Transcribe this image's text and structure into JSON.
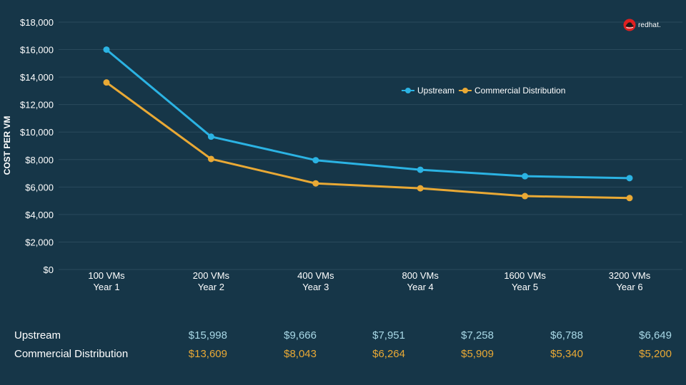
{
  "logo": {
    "text": "redhat."
  },
  "colors": {
    "background": "#163648",
    "upstream": "#2BB3E3",
    "commercial": "#E9A935",
    "grid": "#2A4A5C",
    "table_upstream_text": "#A8D8E6"
  },
  "chart_data": {
    "type": "line",
    "categories": [
      [
        "100 VMs",
        "Year 1"
      ],
      [
        "200 VMs",
        "Year 2"
      ],
      [
        "400 VMs",
        "Year 3"
      ],
      [
        "800 VMs",
        "Year 4"
      ],
      [
        "1600 VMs",
        "Year 5"
      ],
      [
        "3200 VMs",
        "Year 6"
      ]
    ],
    "series": [
      {
        "name": "Upstream",
        "values": [
          15998,
          9666,
          7951,
          7258,
          6788,
          6649
        ]
      },
      {
        "name": "Commercial Distribution",
        "values": [
          13609,
          8043,
          6264,
          5909,
          5340,
          5200
        ]
      }
    ],
    "ylabel": "COST PER VM",
    "xlabel": "",
    "ylim": [
      0,
      18000
    ],
    "yticks": [
      0,
      2000,
      4000,
      6000,
      8000,
      10000,
      12000,
      14000,
      16000,
      18000
    ],
    "ytick_labels": [
      "$0",
      "$2,000",
      "$4,000",
      "$6,000",
      "$8,000",
      "$10,000",
      "$12,000",
      "$14,000",
      "$16,000",
      "$18,000"
    ],
    "grid": true,
    "legend_placement": "upper-right"
  },
  "table": {
    "rows": [
      {
        "name": "Upstream",
        "values": [
          "$15,998",
          "$9,666",
          "$7,951",
          "$7,258",
          "$6,788",
          "$6,649"
        ]
      },
      {
        "name": "Commercial Distribution",
        "values": [
          "$13,609",
          "$8,043",
          "$6,264",
          "$5,909",
          "$5,340",
          "$5,200"
        ]
      }
    ]
  }
}
